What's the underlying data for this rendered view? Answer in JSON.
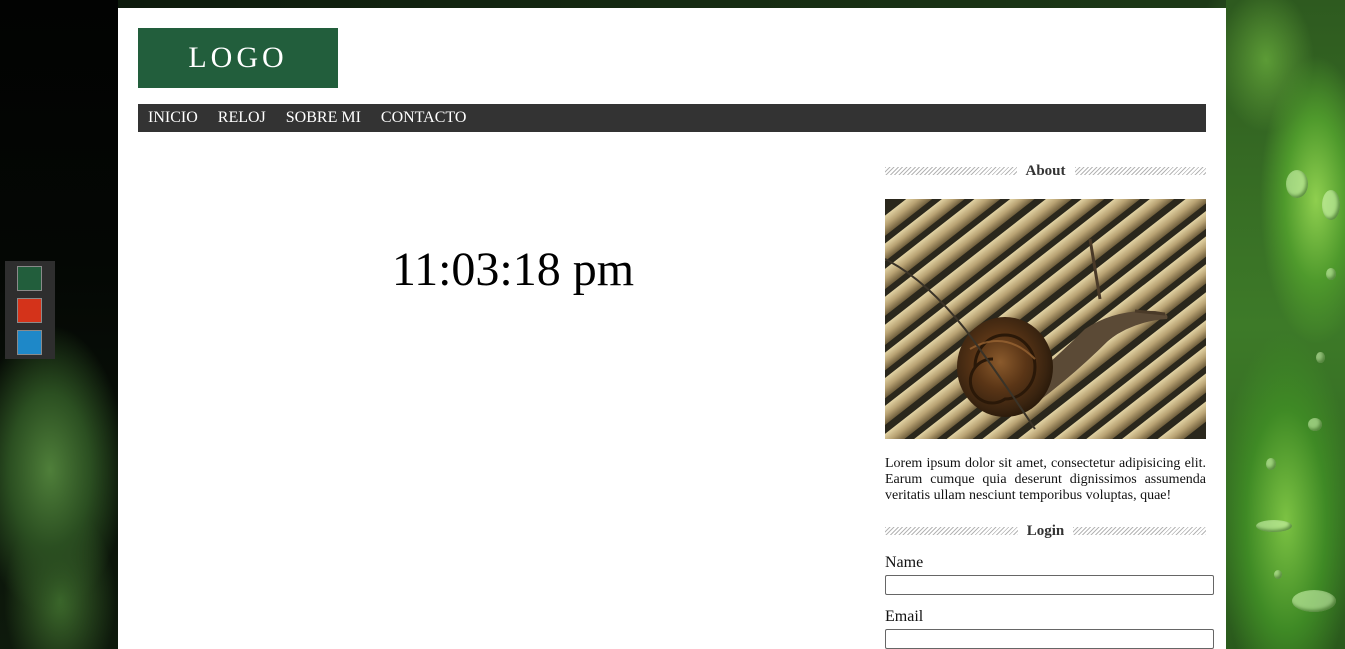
{
  "logo": {
    "text": "LOGO",
    "color": "#225e3c"
  },
  "nav": {
    "items": [
      {
        "label": "INICIO"
      },
      {
        "label": "RELOJ"
      },
      {
        "label": "SOBRE MI"
      },
      {
        "label": "CONTACTO"
      }
    ]
  },
  "clock": {
    "time": "11:03:18 pm"
  },
  "sidebar": {
    "about": {
      "title": "About",
      "image": "snail-on-bamboo-photo",
      "text": "Lorem ipsum dolor sit amet, consectetur adipisicing elit. Earum cumque quia deserunt dignissimos assumenda veritatis ullam nesciunt temporibus voluptas, quae!"
    },
    "login": {
      "title": "Login",
      "name_label": "Name",
      "name_value": "",
      "email_label": "Email",
      "email_value": ""
    }
  },
  "theme_switcher": {
    "colors": [
      "#225e3c",
      "#d4331a",
      "#1e88c8"
    ]
  }
}
